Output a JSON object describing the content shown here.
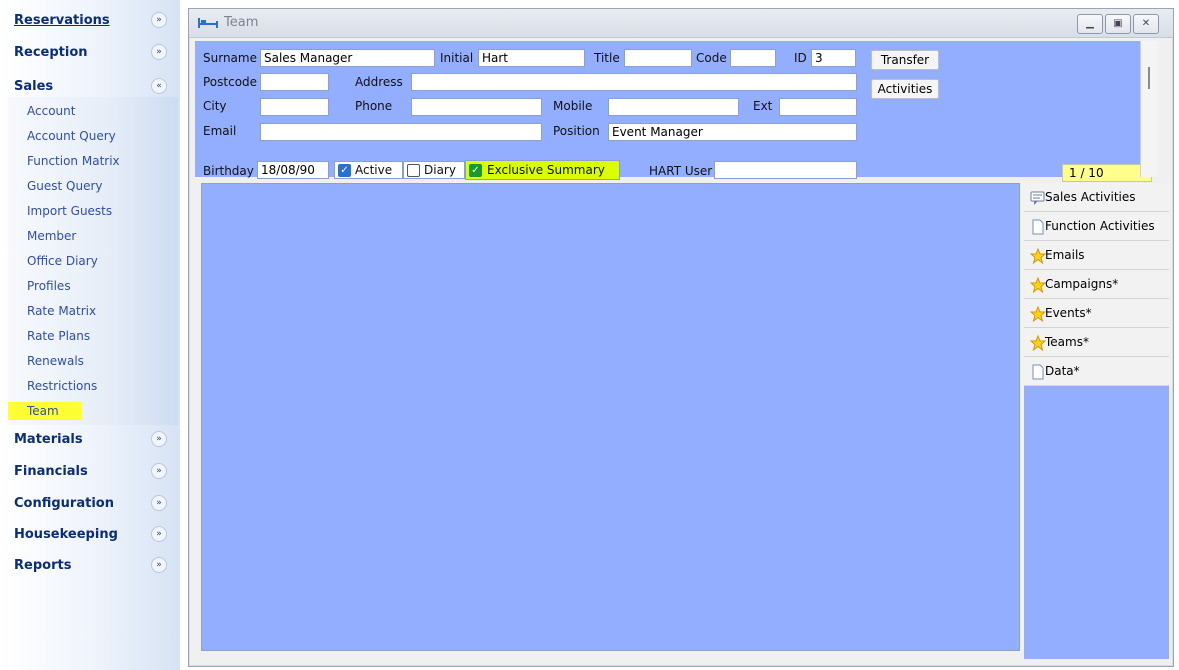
{
  "nav": {
    "sections": [
      {
        "label": "Reservations",
        "expanded": false
      },
      {
        "label": "Reception",
        "expanded": false
      },
      {
        "label": "Sales",
        "expanded": true
      },
      {
        "label": "Materials",
        "expanded": false
      },
      {
        "label": "Financials",
        "expanded": false
      },
      {
        "label": "Configuration",
        "expanded": false
      },
      {
        "label": "Housekeeping",
        "expanded": false
      },
      {
        "label": "Reports",
        "expanded": false
      }
    ],
    "sales_items": [
      "Account",
      "Account Query",
      "Function Matrix",
      "Guest Query",
      "Import Guests",
      "Member",
      "Office Diary",
      "Profiles",
      "Rate Matrix",
      "Rate Plans",
      "Renewals",
      "Restrictions",
      "Team"
    ],
    "selected_item": "Team"
  },
  "window": {
    "title": "Team",
    "icon": "bed-icon"
  },
  "form": {
    "surname": {
      "label": "Surname",
      "value": "Sales Manager"
    },
    "initial": {
      "label": "Initial",
      "value": "Hart"
    },
    "title": {
      "label": "Title",
      "value": ""
    },
    "code": {
      "label": "Code",
      "value": ""
    },
    "id": {
      "label": "ID",
      "value": "3"
    },
    "postcode": {
      "label": "Postcode",
      "value": ""
    },
    "address": {
      "label": "Address",
      "value": ""
    },
    "city": {
      "label": "City",
      "value": ""
    },
    "phone": {
      "label": "Phone",
      "value": ""
    },
    "mobile": {
      "label": "Mobile",
      "value": ""
    },
    "ext": {
      "label": "Ext",
      "value": ""
    },
    "email": {
      "label": "Email",
      "value": ""
    },
    "position": {
      "label": "Position",
      "value": "Event Manager"
    },
    "birthday": {
      "label": "Birthday",
      "value": "18/08/90"
    },
    "active": {
      "label": "Active",
      "checked": true
    },
    "diary": {
      "label": "Diary",
      "checked": false
    },
    "exclusive_summary": {
      "label": "Exclusive Summary",
      "checked": true
    },
    "hart_user": {
      "label": "HART User",
      "value": ""
    },
    "transfer_button": "Transfer",
    "activities_button": "Activities",
    "record_counter": "1 / 10"
  },
  "side_panel": {
    "items": [
      {
        "label": "Sales Activities",
        "icon": "chat-icon"
      },
      {
        "label": "Function Activities",
        "icon": "document-icon"
      },
      {
        "label": "Emails",
        "icon": "star-icon"
      },
      {
        "label": "Campaigns*",
        "icon": "star-icon"
      },
      {
        "label": "Events*",
        "icon": "star-icon"
      },
      {
        "label": "Teams*",
        "icon": "star-icon"
      },
      {
        "label": "Data*",
        "icon": "document-icon"
      }
    ]
  },
  "colors": {
    "panel_blue": "#93aeff",
    "highlight_yellow": "#ffff33",
    "exclusive_green": "#d9ff00",
    "nav_text": "#0b2d7a",
    "link_text": "#2f4fa8"
  }
}
